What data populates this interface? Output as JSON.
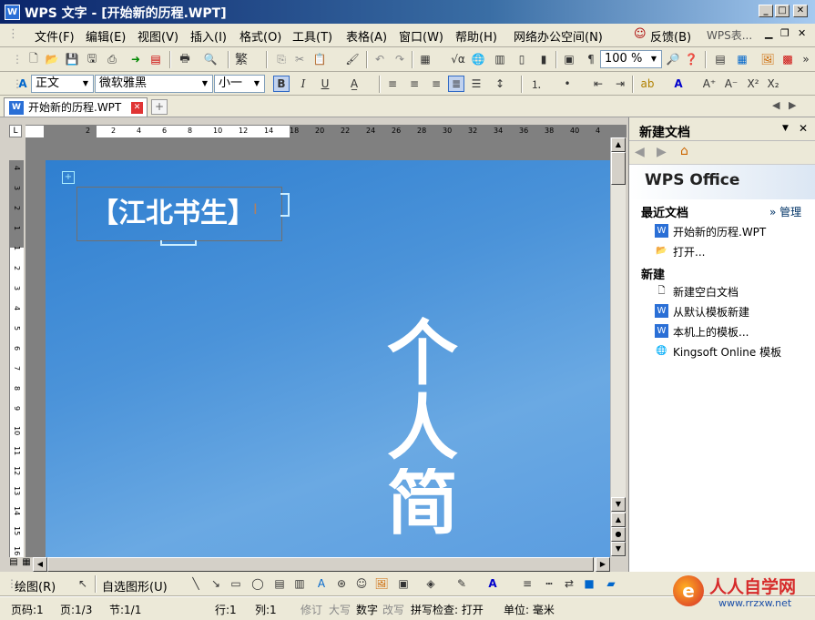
{
  "window": {
    "title": "WPS 文字 - [开始新的历程.WPT]",
    "app_icon": "W"
  },
  "menu": {
    "items": [
      "文件(F)",
      "编辑(E)",
      "视图(V)",
      "插入(I)",
      "格式(O)",
      "工具(T)",
      "表格(A)",
      "窗口(W)",
      "帮助(H)",
      "网络办公空间(N)",
      "反馈(B)",
      "WPS表..."
    ]
  },
  "format_bar": {
    "style_value": "正文",
    "font_value": "微软雅黑",
    "size_value": "小一",
    "bold": "B",
    "italic": "I",
    "underline": "U"
  },
  "toolbar": {
    "zoom_value": "100 %",
    "traditional": "繁"
  },
  "document_tab": {
    "label": "开始新的历程.WPT"
  },
  "ruler": {
    "h_ticks": [
      "2",
      "2",
      "4",
      "6",
      "8",
      "10",
      "12",
      "14",
      "18",
      "20",
      "22",
      "24",
      "26",
      "28",
      "30",
      "32",
      "34",
      "36",
      "38",
      "40",
      "4"
    ],
    "v_ticks": [
      "4",
      "3",
      "2",
      "1",
      "1",
      "2",
      "3",
      "4",
      "5",
      "6",
      "7",
      "8",
      "9",
      "10",
      "11",
      "12",
      "13",
      "14",
      "15",
      "16"
    ]
  },
  "page": {
    "box_text": "【江北书生】",
    "big_text": [
      "个",
      "人",
      "简"
    ]
  },
  "task_pane": {
    "title": "新建文档",
    "brand": "WPS Office",
    "recent_label": "最近文档",
    "manage_label": "» 管理",
    "recent_items": [
      "开始新的历程.WPT",
      "打开..."
    ],
    "new_label": "新建",
    "new_items": [
      "新建空白文档",
      "从默认模板新建",
      "本机上的模板...",
      "Kingsoft Online 模板"
    ]
  },
  "draw_bar": {
    "draw_label": "绘图(R)",
    "autoshape_label": "自选图形(U)"
  },
  "status": {
    "page": "页码:1",
    "pages": "页:1/3",
    "section": "节:1/1",
    "row": "行:1",
    "col": "列:1",
    "rev": "修订",
    "caps": "大写",
    "num": "数字",
    "ovr": "改写",
    "spell": "拼写检查: 打开",
    "unit": "单位: 毫米"
  },
  "watermark": {
    "name": "人人自学网",
    "url": "www.rrzxw.net"
  },
  "colors": {
    "page_blue": "#4b93d9",
    "title_blue": "#0a246a",
    "watermark_red": "#d62b2b"
  }
}
